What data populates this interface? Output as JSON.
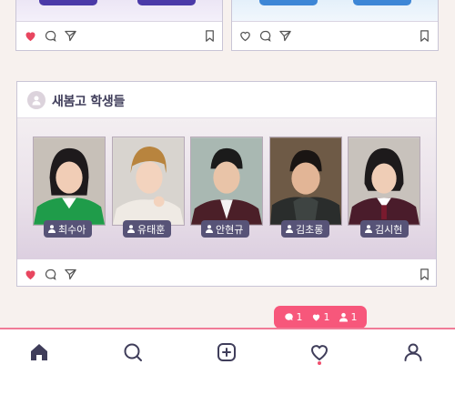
{
  "feed": {
    "top_left_card": {
      "liked": true
    },
    "top_right_card": {
      "liked": false
    },
    "main_card": {
      "title": "새봄고 학생들",
      "liked": true,
      "students": [
        {
          "name": "최수아"
        },
        {
          "name": "유태훈"
        },
        {
          "name": "안현규"
        },
        {
          "name": "김초롱"
        },
        {
          "name": "김시현"
        }
      ]
    }
  },
  "notification": {
    "comments": "1",
    "likes": "1",
    "followers": "1"
  },
  "nav": {
    "items": [
      "home-icon",
      "search-icon",
      "add-icon",
      "activity-heart-icon",
      "profile-icon"
    ],
    "active": "activity-heart-icon"
  },
  "colors": {
    "accent": "#f7577b",
    "tag": "#575377",
    "like": "#e8465f"
  }
}
